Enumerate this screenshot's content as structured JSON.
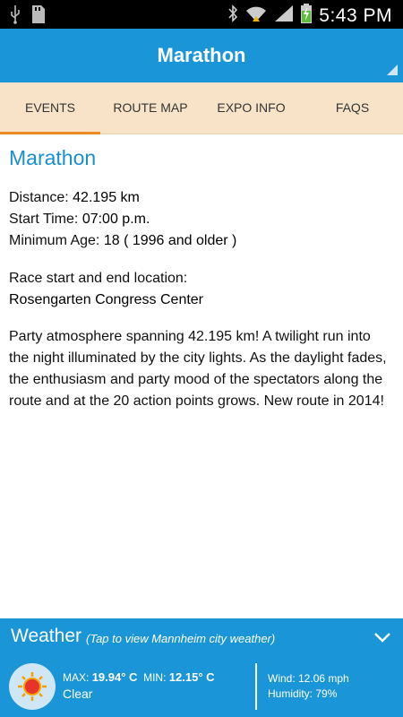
{
  "status_bar": {
    "time": "5:43 PM",
    "icons": [
      "usb-icon",
      "sd-card-icon",
      "bluetooth-icon",
      "wifi-icon",
      "signal-icon",
      "battery-charging-icon"
    ]
  },
  "app_bar": {
    "title": "Marathon"
  },
  "tabs": [
    {
      "label": "EVENTS",
      "active": true
    },
    {
      "label": "ROUTE MAP",
      "active": false
    },
    {
      "label": "EXPO INFO",
      "active": false
    },
    {
      "label": "FAQS",
      "active": false
    }
  ],
  "event": {
    "title": "Marathon",
    "distance_label": "Distance:",
    "distance_value": "42.195 km",
    "start_label": "Start Time:",
    "start_value": "07:00 p.m.",
    "age_label": "Minimum Age:",
    "age_value": "18 ( 1996 and older )",
    "location_label": "Race start and end location:",
    "location_value": "Rosengarten Congress Center",
    "description": "Party atmosphere spanning 42.195 km! A twilight run into the night illuminated by the city lights. As the daylight fades, the enthusiasm and party mood of the spectators along the route and at the 20 action points grows. New route in 2014!"
  },
  "weather": {
    "title": "Weather",
    "hint": "(Tap to view Mannheim city weather)",
    "max_label": "MAX:",
    "max_value": "19.94° C",
    "min_label": "MIN:",
    "min_value": "12.15° C",
    "condition": "Clear",
    "wind": "Wind: 12.06 mph",
    "humidity": "Humidity: 79%",
    "icon": "sun-icon"
  },
  "colors": {
    "primary": "#1a96d8",
    "tab_bg": "#f9e3c8",
    "tab_active": "#f08a24",
    "title_blue": "#1a8fcf"
  }
}
